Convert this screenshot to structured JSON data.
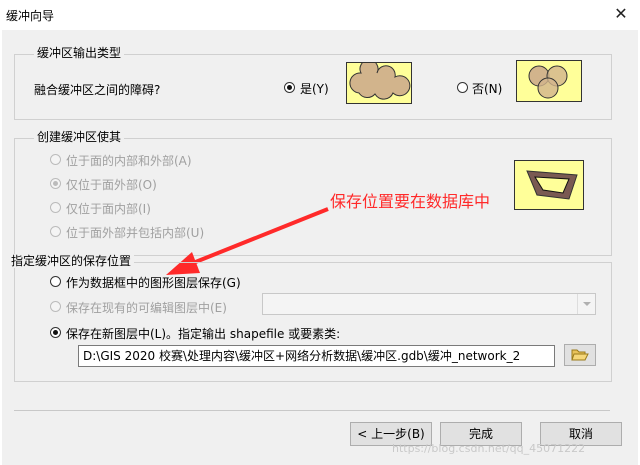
{
  "window": {
    "title": "缓冲向导",
    "close_glyph": "✕"
  },
  "output_type": {
    "group_title": "缓冲区输出类型",
    "question": "融合缓冲区之间的障碍?",
    "yes_label": "是(Y)",
    "no_label": "否(N)",
    "selected": "yes"
  },
  "side_type": {
    "group_title": "创建缓冲区使其",
    "options": [
      {
        "label": "位于面的内部和外部(A)",
        "selected": false,
        "enabled": false
      },
      {
        "label": "仅位于面外部(O)",
        "selected": true,
        "enabled": false
      },
      {
        "label": "仅位于面内部(I)",
        "selected": false,
        "enabled": false
      },
      {
        "label": "位于面外部并包括内部(U)",
        "selected": false,
        "enabled": false
      }
    ]
  },
  "annotation": {
    "text": "保存位置要在数据库中",
    "color": "#ff2a2a"
  },
  "save_location": {
    "group_title": "指定缓冲区的保存位置",
    "opt_graphics": "作为数据框中的图形图层保存(G)",
    "opt_existing": "保存在现有的可编辑图层中(E)",
    "opt_new": "保存在新图层中(L)。指定输出 shapefile 或要素类:",
    "selected": "new",
    "output_path": "D:\\GIS 2020 校赛\\处理内容\\缓冲区+网络分析数据\\缓冲区.gdb\\缓冲_network_2"
  },
  "buttons": {
    "back": "< 上一步(B)",
    "finish": "完成",
    "cancel": "取消"
  },
  "watermark": "https://blog.csdn.net/qq_45071222",
  "colors": {
    "preview_fill": "#ffff99",
    "buffer_fill": "#d2b48c",
    "arrow": "#ff2a2a"
  }
}
